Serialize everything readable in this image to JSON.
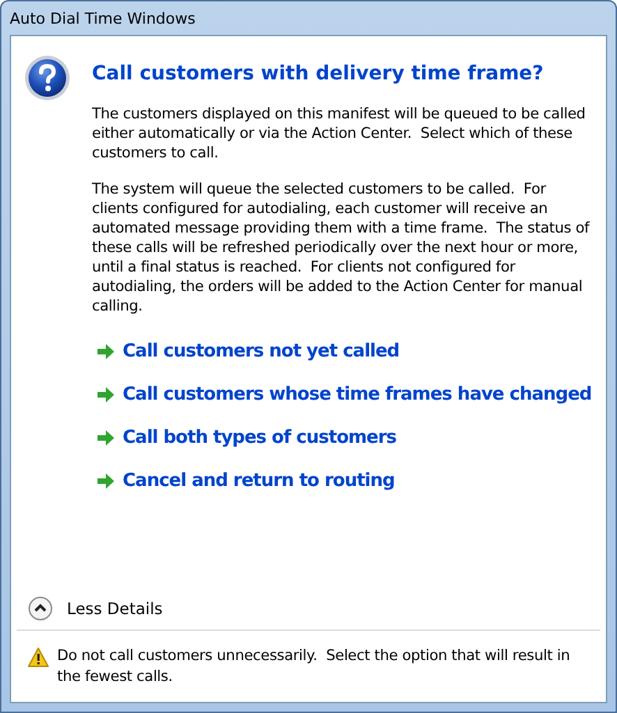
{
  "window": {
    "title": "Auto Dial Time Windows"
  },
  "heading": "Call customers with delivery time frame?",
  "paragraphs": [
    "The customers displayed on this manifest will be queued to be called either automatically or via the Action Center.  Select which of these customers to call.",
    "The system will queue the selected customers to be called.  For clients configured for autodialing, each customer will receive an automated message providing them with a time frame.  The status of these calls will be refreshed periodically over the next hour or more, until a final status is reached.  For clients not configured for autodialing, the orders will be added to the Action Center for manual calling."
  ],
  "commands": [
    "Call customers not yet called",
    "Call customers whose time frames have changed",
    "Call both types of customers",
    "Cancel and return to routing"
  ],
  "details_toggle": {
    "label": "Less Details",
    "expanded": true
  },
  "footer": "Do not call customers unnecessarily.  Select the option that will result in the fewest calls."
}
